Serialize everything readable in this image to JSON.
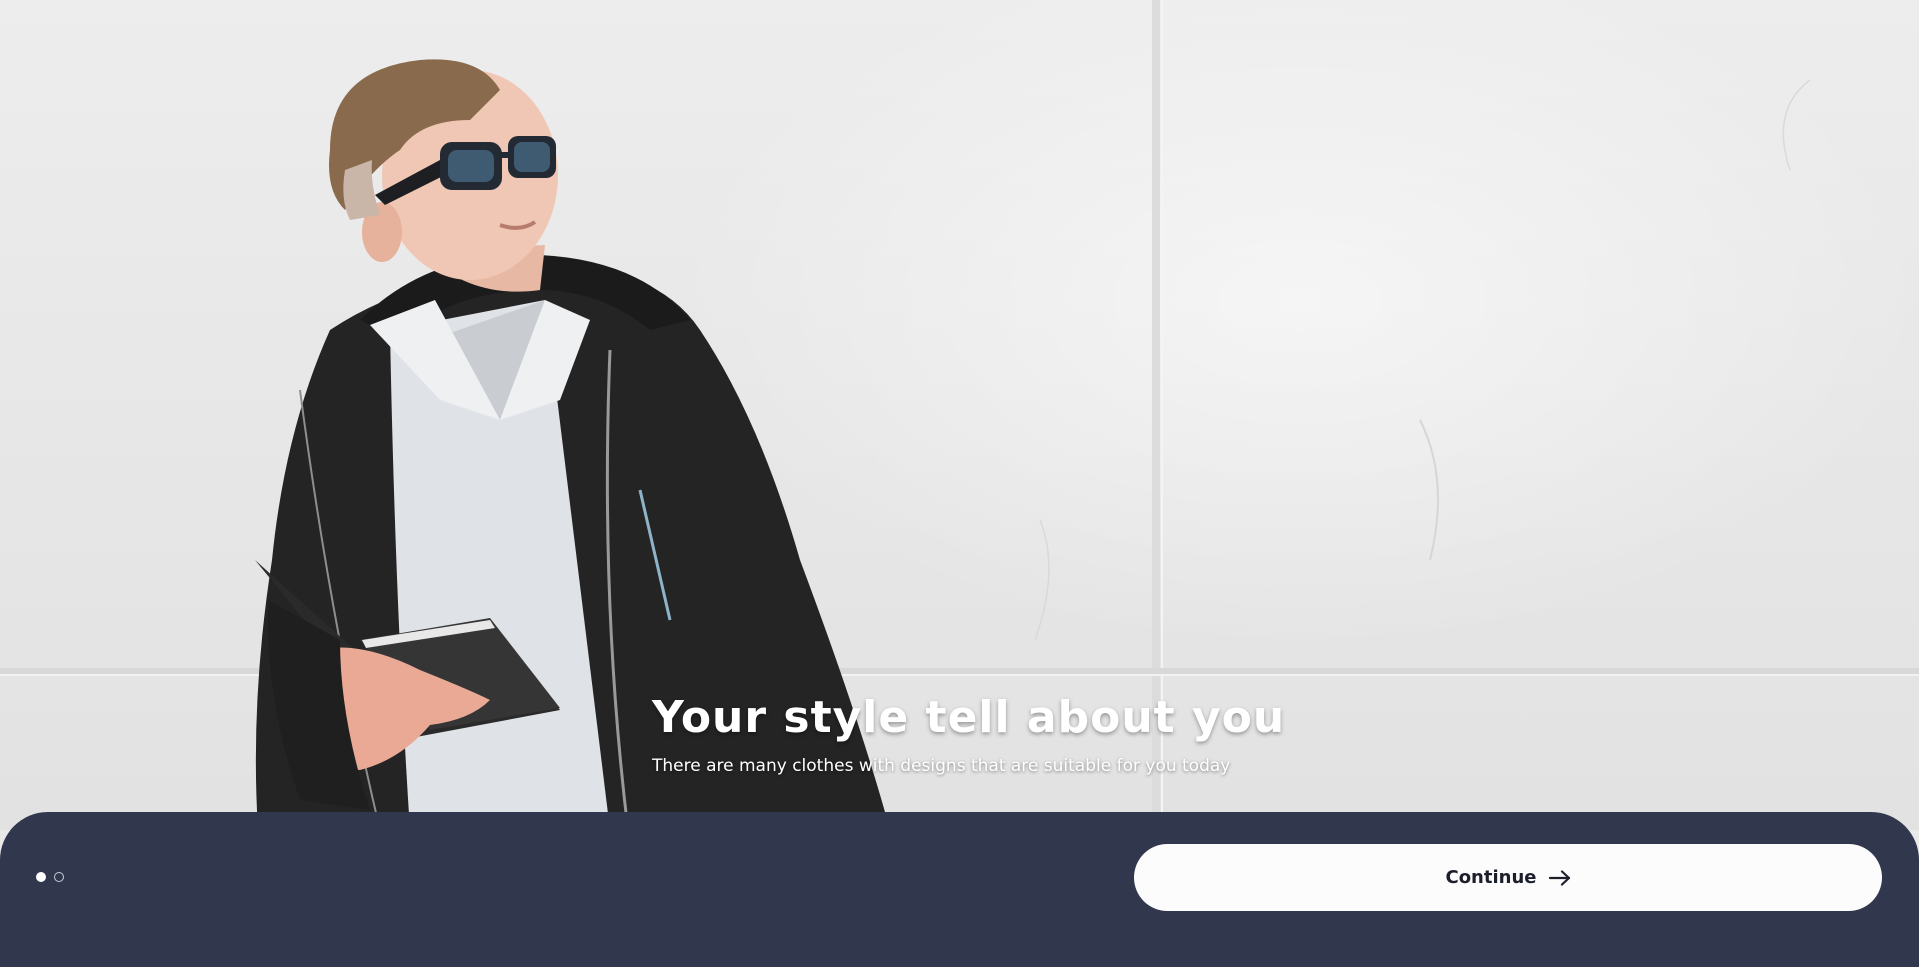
{
  "hero": {
    "title": "Your style tell about you",
    "subtitle": "There are many clothes with designs that are suitable for you today",
    "image": "man-in-sunglasses-holding-notebook"
  },
  "pager": {
    "total": 2,
    "active_index": 0
  },
  "actions": {
    "continue_label": "Continue",
    "continue_icon": "arrow-right-icon"
  },
  "colors": {
    "panel": "#31384e",
    "button_bg": "#fcfcfc",
    "button_text": "#1c1f2b",
    "text_on_image": "#ffffff"
  }
}
